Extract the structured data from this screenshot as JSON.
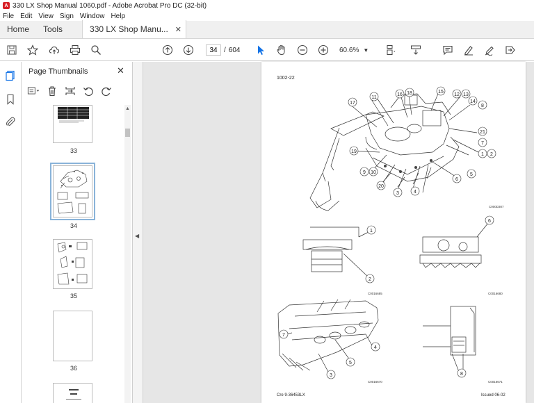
{
  "window": {
    "title": "330 LX Shop Manual 1060.pdf - Adobe Acrobat Pro DC (32-bit)"
  },
  "menu": [
    "File",
    "Edit",
    "View",
    "Sign",
    "Window",
    "Help"
  ],
  "tabs": {
    "home": "Home",
    "tools": "Tools",
    "document": "330 LX Shop Manu..."
  },
  "toolbar": {
    "current_page": "34",
    "page_count": "604",
    "zoom": "60.6%"
  },
  "panel": {
    "title": "Page Thumbnails",
    "thumbnails": [
      {
        "label": "33"
      },
      {
        "label": "34"
      },
      {
        "label": "35"
      },
      {
        "label": "36"
      }
    ]
  },
  "document_page": {
    "section_code": "1002-22",
    "footer_left": "Cre 9-36453LX",
    "footer_right": "Issued 06-02",
    "figure_codes": [
      "C000D307",
      "C0016685",
      "C0016680",
      "C0016670",
      "C0016671"
    ],
    "callouts": [
      "1",
      "2",
      "3",
      "4",
      "5",
      "6",
      "7",
      "8",
      "9",
      "10",
      "11",
      "12",
      "13",
      "14",
      "15",
      "16",
      "17",
      "18",
      "19",
      "20",
      "21"
    ]
  },
  "colors": {
    "accent": "#1473e6",
    "brand": "#d71f26",
    "selection": "#89b3d9"
  },
  "icons": {
    "app": "acrobat-icon",
    "rail": [
      "page-thumbnails-icon",
      "bookmark-icon",
      "attachment-icon"
    ]
  }
}
